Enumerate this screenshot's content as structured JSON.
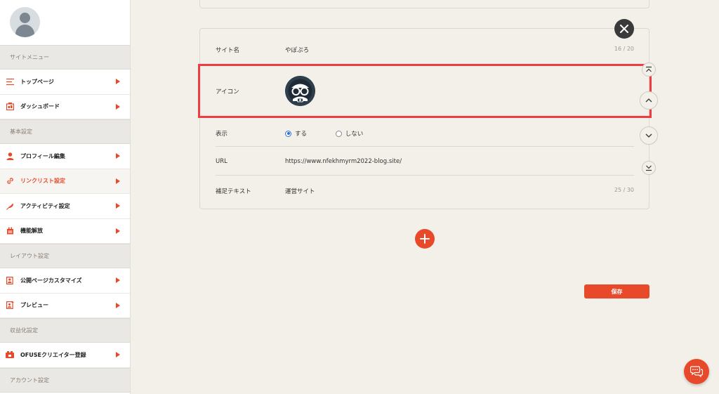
{
  "sidebar": {
    "sections": [
      {
        "header": "サイトメニュー",
        "items": [
          {
            "label": "トップページ",
            "icon": "list-icon"
          },
          {
            "label": "ダッシュボード",
            "icon": "dashboard-icon"
          }
        ]
      },
      {
        "header": "基本設定",
        "items": [
          {
            "label": "プロフィール編集",
            "icon": "user-icon"
          },
          {
            "label": "リンクリスト設定",
            "icon": "link-icon",
            "active": true
          },
          {
            "label": "アクティビティ設定",
            "icon": "feather-icon"
          },
          {
            "label": "機能解放",
            "icon": "unlock-icon"
          }
        ]
      },
      {
        "header": "レイアウト設定",
        "items": [
          {
            "label": "公開ページカスタマイズ",
            "icon": "customize-icon"
          },
          {
            "label": "プレビュー",
            "icon": "preview-icon"
          }
        ]
      },
      {
        "header": "収益化設定",
        "items": [
          {
            "label": "OFUSEクリエイター登録",
            "icon": "ofuse-icon"
          }
        ]
      },
      {
        "header": "アカウント設定",
        "items": []
      }
    ]
  },
  "link_form": {
    "site_name": {
      "label": "サイト名",
      "value": "やぽぷろ",
      "count": "16 / 20"
    },
    "icon": {
      "label": "アイコン"
    },
    "display": {
      "label": "表示",
      "options": [
        {
          "label": "する",
          "selected": true
        },
        {
          "label": "しない",
          "selected": false
        }
      ]
    },
    "url": {
      "label": "URL",
      "value": "https://www.nfekhmyrm2022-blog.site/"
    },
    "supplement": {
      "label": "補足テキスト",
      "value": "運営サイト",
      "count": "25 / 30"
    }
  },
  "save_label": "保存",
  "colors": {
    "accent": "#e8492a",
    "highlight": "#ef3b42",
    "background": "#f3f0ea"
  }
}
